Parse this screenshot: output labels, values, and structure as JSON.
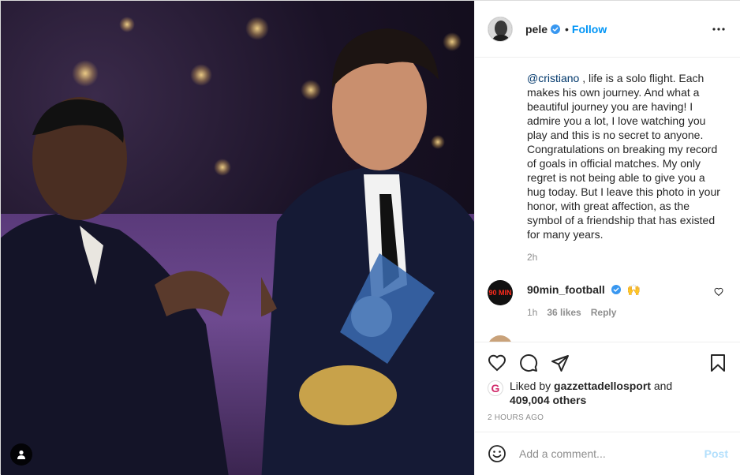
{
  "header": {
    "username": "pele",
    "follow_label": "Follow",
    "separator": "•"
  },
  "caption": {
    "mention": "@cristiano",
    "text": " , life is a solo flight. Each makes his own journey. And what a beautiful journey you are having! I admire you a lot, I love watching you play and this is no secret to anyone. Congratulations on breaking my record of goals in official matches. My only regret is not being able to give you a hug today. But I leave this photo in your honor, with great affection, as the symbol of a friendship that has existed for many years.",
    "age": "2h"
  },
  "comments": [
    {
      "username": "90min_football",
      "text": "🙌",
      "age": "1h",
      "likes": "36 likes",
      "reply_label": "Reply",
      "avatar_text": "90 MIN"
    }
  ],
  "likes": {
    "prefix": "Liked by ",
    "user": "gazzettadellosport",
    "middle": " and",
    "count": "409,004 others",
    "avatar_letter": "G"
  },
  "timestamp": "2 hours ago",
  "add_comment": {
    "placeholder": "Add a comment...",
    "post_label": "Post"
  },
  "colors": {
    "accent": "#0095f6",
    "post_disabled": "#b2dffc",
    "mention": "#00376b",
    "muted": "#8e8e8e"
  },
  "icons": [
    "verified-badge-icon",
    "more-options-icon",
    "heart-icon",
    "comment-icon",
    "share-icon",
    "bookmark-icon",
    "emoji-icon",
    "user-tag-icon"
  ]
}
